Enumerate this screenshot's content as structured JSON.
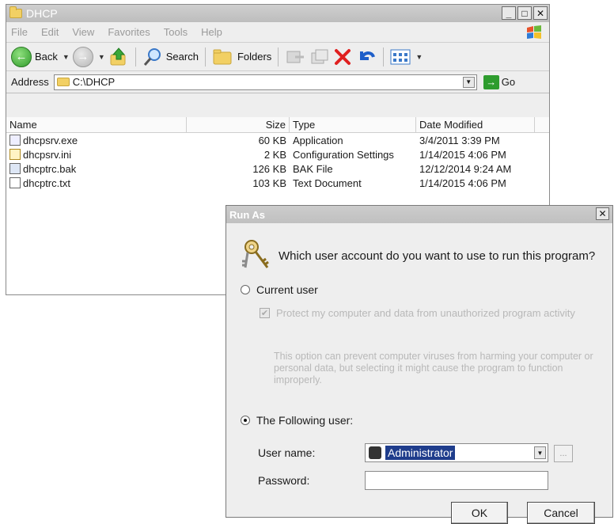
{
  "explorer": {
    "title": "DHCP",
    "menus": [
      "File",
      "Edit",
      "View",
      "Favorites",
      "Tools",
      "Help"
    ],
    "toolbar": {
      "back": "Back",
      "search": "Search",
      "folders": "Folders"
    },
    "address": {
      "label": "Address",
      "value": "C:\\DHCP",
      "go": "Go"
    },
    "columns": {
      "name": "Name",
      "size": "Size",
      "type": "Type",
      "date": "Date Modified"
    },
    "files": [
      {
        "name": "dhcpsrv.exe",
        "size": "60 KB",
        "type": "Application",
        "date": "3/4/2011 3:39 PM",
        "icon": "exe-icon"
      },
      {
        "name": "dhcpsrv.ini",
        "size": "2 KB",
        "type": "Configuration Settings",
        "date": "1/14/2015 4:06 PM",
        "icon": "ini-icon"
      },
      {
        "name": "dhcptrc.bak",
        "size": "126 KB",
        "type": "BAK File",
        "date": "12/12/2014 9:24 AM",
        "icon": "bak-icon"
      },
      {
        "name": "dhcptrc.txt",
        "size": "103 KB",
        "type": "Text Document",
        "date": "1/14/2015 4:06 PM",
        "icon": "txt-icon"
      }
    ]
  },
  "runas": {
    "title": "Run As",
    "question": "Which user account do you want to use to run this program?",
    "current_user": "Current user",
    "protect": "Protect my computer and data from unauthorized program activity",
    "description": "This option can prevent computer viruses from harming your computer or personal data, but selecting it might cause the program to function improperly.",
    "following_user": "The Following user:",
    "username_label": "User name:",
    "username_value": "Administrator",
    "password_label": "Password:",
    "ok": "OK",
    "cancel": "Cancel",
    "browse": "..."
  }
}
